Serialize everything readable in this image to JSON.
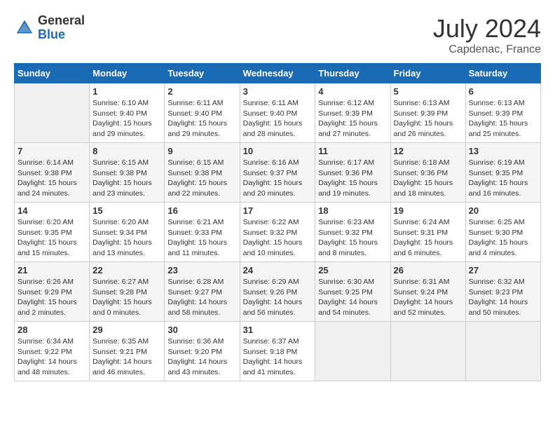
{
  "logo": {
    "general": "General",
    "blue": "Blue"
  },
  "title": "July 2024",
  "location": "Capdenac, France",
  "days_of_week": [
    "Sunday",
    "Monday",
    "Tuesday",
    "Wednesday",
    "Thursday",
    "Friday",
    "Saturday"
  ],
  "weeks": [
    [
      {
        "day": "",
        "info": ""
      },
      {
        "day": "1",
        "info": "Sunrise: 6:10 AM\nSunset: 9:40 PM\nDaylight: 15 hours\nand 29 minutes."
      },
      {
        "day": "2",
        "info": "Sunrise: 6:11 AM\nSunset: 9:40 PM\nDaylight: 15 hours\nand 29 minutes."
      },
      {
        "day": "3",
        "info": "Sunrise: 6:11 AM\nSunset: 9:40 PM\nDaylight: 15 hours\nand 28 minutes."
      },
      {
        "day": "4",
        "info": "Sunrise: 6:12 AM\nSunset: 9:39 PM\nDaylight: 15 hours\nand 27 minutes."
      },
      {
        "day": "5",
        "info": "Sunrise: 6:13 AM\nSunset: 9:39 PM\nDaylight: 15 hours\nand 26 minutes."
      },
      {
        "day": "6",
        "info": "Sunrise: 6:13 AM\nSunset: 9:39 PM\nDaylight: 15 hours\nand 25 minutes."
      }
    ],
    [
      {
        "day": "7",
        "info": "Sunrise: 6:14 AM\nSunset: 9:38 PM\nDaylight: 15 hours\nand 24 minutes."
      },
      {
        "day": "8",
        "info": "Sunrise: 6:15 AM\nSunset: 9:38 PM\nDaylight: 15 hours\nand 23 minutes."
      },
      {
        "day": "9",
        "info": "Sunrise: 6:15 AM\nSunset: 9:38 PM\nDaylight: 15 hours\nand 22 minutes."
      },
      {
        "day": "10",
        "info": "Sunrise: 6:16 AM\nSunset: 9:37 PM\nDaylight: 15 hours\nand 20 minutes."
      },
      {
        "day": "11",
        "info": "Sunrise: 6:17 AM\nSunset: 9:36 PM\nDaylight: 15 hours\nand 19 minutes."
      },
      {
        "day": "12",
        "info": "Sunrise: 6:18 AM\nSunset: 9:36 PM\nDaylight: 15 hours\nand 18 minutes."
      },
      {
        "day": "13",
        "info": "Sunrise: 6:19 AM\nSunset: 9:35 PM\nDaylight: 15 hours\nand 16 minutes."
      }
    ],
    [
      {
        "day": "14",
        "info": "Sunrise: 6:20 AM\nSunset: 9:35 PM\nDaylight: 15 hours\nand 15 minutes."
      },
      {
        "day": "15",
        "info": "Sunrise: 6:20 AM\nSunset: 9:34 PM\nDaylight: 15 hours\nand 13 minutes."
      },
      {
        "day": "16",
        "info": "Sunrise: 6:21 AM\nSunset: 9:33 PM\nDaylight: 15 hours\nand 11 minutes."
      },
      {
        "day": "17",
        "info": "Sunrise: 6:22 AM\nSunset: 9:32 PM\nDaylight: 15 hours\nand 10 minutes."
      },
      {
        "day": "18",
        "info": "Sunrise: 6:23 AM\nSunset: 9:32 PM\nDaylight: 15 hours\nand 8 minutes."
      },
      {
        "day": "19",
        "info": "Sunrise: 6:24 AM\nSunset: 9:31 PM\nDaylight: 15 hours\nand 6 minutes."
      },
      {
        "day": "20",
        "info": "Sunrise: 6:25 AM\nSunset: 9:30 PM\nDaylight: 15 hours\nand 4 minutes."
      }
    ],
    [
      {
        "day": "21",
        "info": "Sunrise: 6:26 AM\nSunset: 9:29 PM\nDaylight: 15 hours\nand 2 minutes."
      },
      {
        "day": "22",
        "info": "Sunrise: 6:27 AM\nSunset: 9:28 PM\nDaylight: 15 hours\nand 0 minutes."
      },
      {
        "day": "23",
        "info": "Sunrise: 6:28 AM\nSunset: 9:27 PM\nDaylight: 14 hours\nand 58 minutes."
      },
      {
        "day": "24",
        "info": "Sunrise: 6:29 AM\nSunset: 9:26 PM\nDaylight: 14 hours\nand 56 minutes."
      },
      {
        "day": "25",
        "info": "Sunrise: 6:30 AM\nSunset: 9:25 PM\nDaylight: 14 hours\nand 54 minutes."
      },
      {
        "day": "26",
        "info": "Sunrise: 6:31 AM\nSunset: 9:24 PM\nDaylight: 14 hours\nand 52 minutes."
      },
      {
        "day": "27",
        "info": "Sunrise: 6:32 AM\nSunset: 9:23 PM\nDaylight: 14 hours\nand 50 minutes."
      }
    ],
    [
      {
        "day": "28",
        "info": "Sunrise: 6:34 AM\nSunset: 9:22 PM\nDaylight: 14 hours\nand 48 minutes."
      },
      {
        "day": "29",
        "info": "Sunrise: 6:35 AM\nSunset: 9:21 PM\nDaylight: 14 hours\nand 46 minutes."
      },
      {
        "day": "30",
        "info": "Sunrise: 6:36 AM\nSunset: 9:20 PM\nDaylight: 14 hours\nand 43 minutes."
      },
      {
        "day": "31",
        "info": "Sunrise: 6:37 AM\nSunset: 9:18 PM\nDaylight: 14 hours\nand 41 minutes."
      },
      {
        "day": "",
        "info": ""
      },
      {
        "day": "",
        "info": ""
      },
      {
        "day": "",
        "info": ""
      }
    ]
  ]
}
